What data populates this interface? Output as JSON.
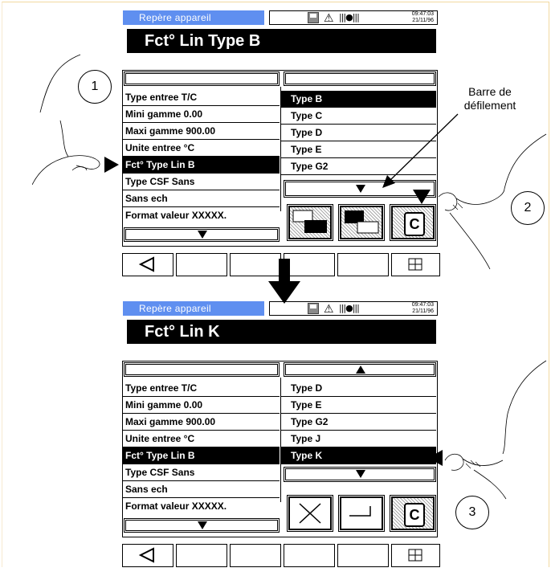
{
  "header": {
    "section_label": "Repère appareil",
    "time": "09:47:03",
    "date": "21/11/96"
  },
  "screen1": {
    "title": "Fct° Lin Type B",
    "params": [
      "Type entree T/C",
      "Mini gamme   0.00",
      "Maxi gamme  900.00",
      "Unite entree °C",
      "Fct° Type Lin B",
      "Type CSF Sans",
      "Sans ech",
      "Format valeur XXXXX."
    ],
    "selected_param_index": 4,
    "options": [
      "Type B",
      "Type C",
      "Type D",
      "Type E",
      "Type G2"
    ],
    "selected_option_index": 0
  },
  "screen2": {
    "title": "Fct° Lin K",
    "params": [
      "Type entree T/C",
      "Mini gamme   0.00",
      "Maxi gamme  900.00",
      "Unite entree °C",
      "Fct° Type Lin B",
      "Type CSF Sans",
      "Sans ech",
      "Format valeur XXXXX."
    ],
    "selected_param_index": 4,
    "options": [
      "Type D",
      "Type E",
      "Type G2",
      "Type J",
      "Type K"
    ],
    "selected_option_index": 4
  },
  "annotations": {
    "step1": "1",
    "step2": "2",
    "step3": "3",
    "scrollbar_note_line1": "Barre de",
    "scrollbar_note_line2": "défilement"
  },
  "icons": [
    "floppy-disk-icon",
    "warning-icon",
    "signal-icon",
    "scroll-down-arrow-icon",
    "scroll-up-arrow-icon",
    "page-left-icon",
    "page-right-icon",
    "copyright-c-icon",
    "cancel-x-icon",
    "enter-icon",
    "back-triangle-icon",
    "grid-icon",
    "hand-pointer-icon"
  ]
}
